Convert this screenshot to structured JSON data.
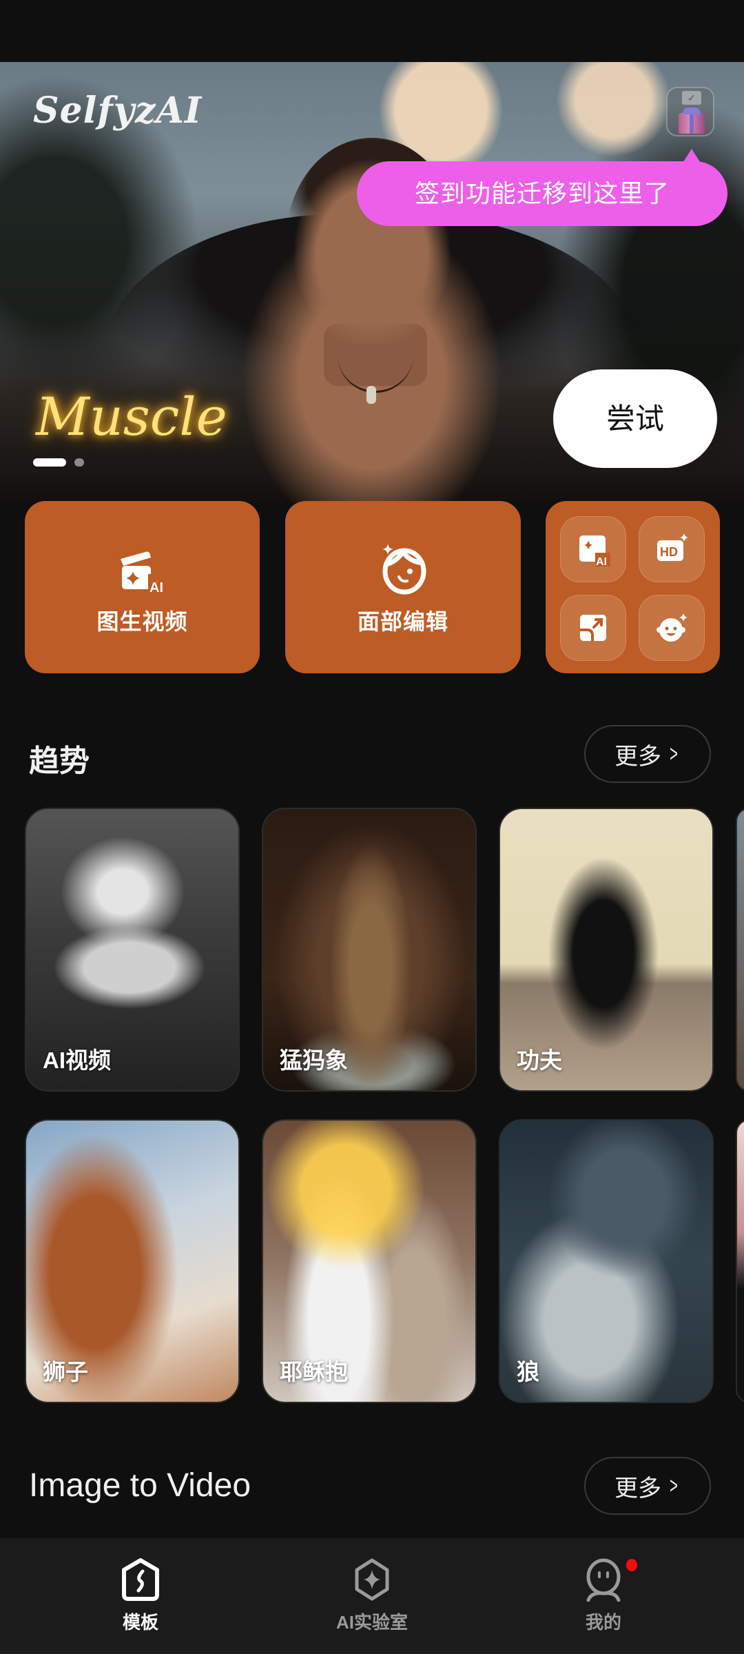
{
  "app": {
    "name": "SelfyzAI"
  },
  "hero": {
    "tooltip": "签到功能迁移到这里了",
    "banner_title": "Muscle",
    "try_button": "尝试",
    "carousel": {
      "total": 2,
      "active_index": 0
    }
  },
  "actions": {
    "image_to_video": "图生视频",
    "face_edit": "面部编辑",
    "tools": [
      {
        "icon": "ai-image-icon"
      },
      {
        "icon": "hd-enhance-icon"
      },
      {
        "icon": "expand-image-icon"
      },
      {
        "icon": "baby-face-icon"
      }
    ]
  },
  "trending": {
    "title": "趋势",
    "more": "更多",
    "items": [
      {
        "label": "AI视频"
      },
      {
        "label": "猛犸象"
      },
      {
        "label": "功夫"
      },
      {
        "label": "狮子"
      },
      {
        "label": "耶稣抱"
      },
      {
        "label": "狼"
      }
    ]
  },
  "image_to_video_section": {
    "title": "Image to Video",
    "more": "更多"
  },
  "nav": {
    "items": [
      {
        "label": "模板",
        "active": true
      },
      {
        "label": "AI实验室",
        "active": false
      },
      {
        "label": "我的",
        "active": false,
        "has_badge": true
      }
    ]
  },
  "colors": {
    "accent_orange": "#bd5c24",
    "tooltip_pink": "#ee5fe9",
    "background": "#0f0f10",
    "nav_background": "#1b1b1b",
    "badge_red": "#f20d0d"
  }
}
